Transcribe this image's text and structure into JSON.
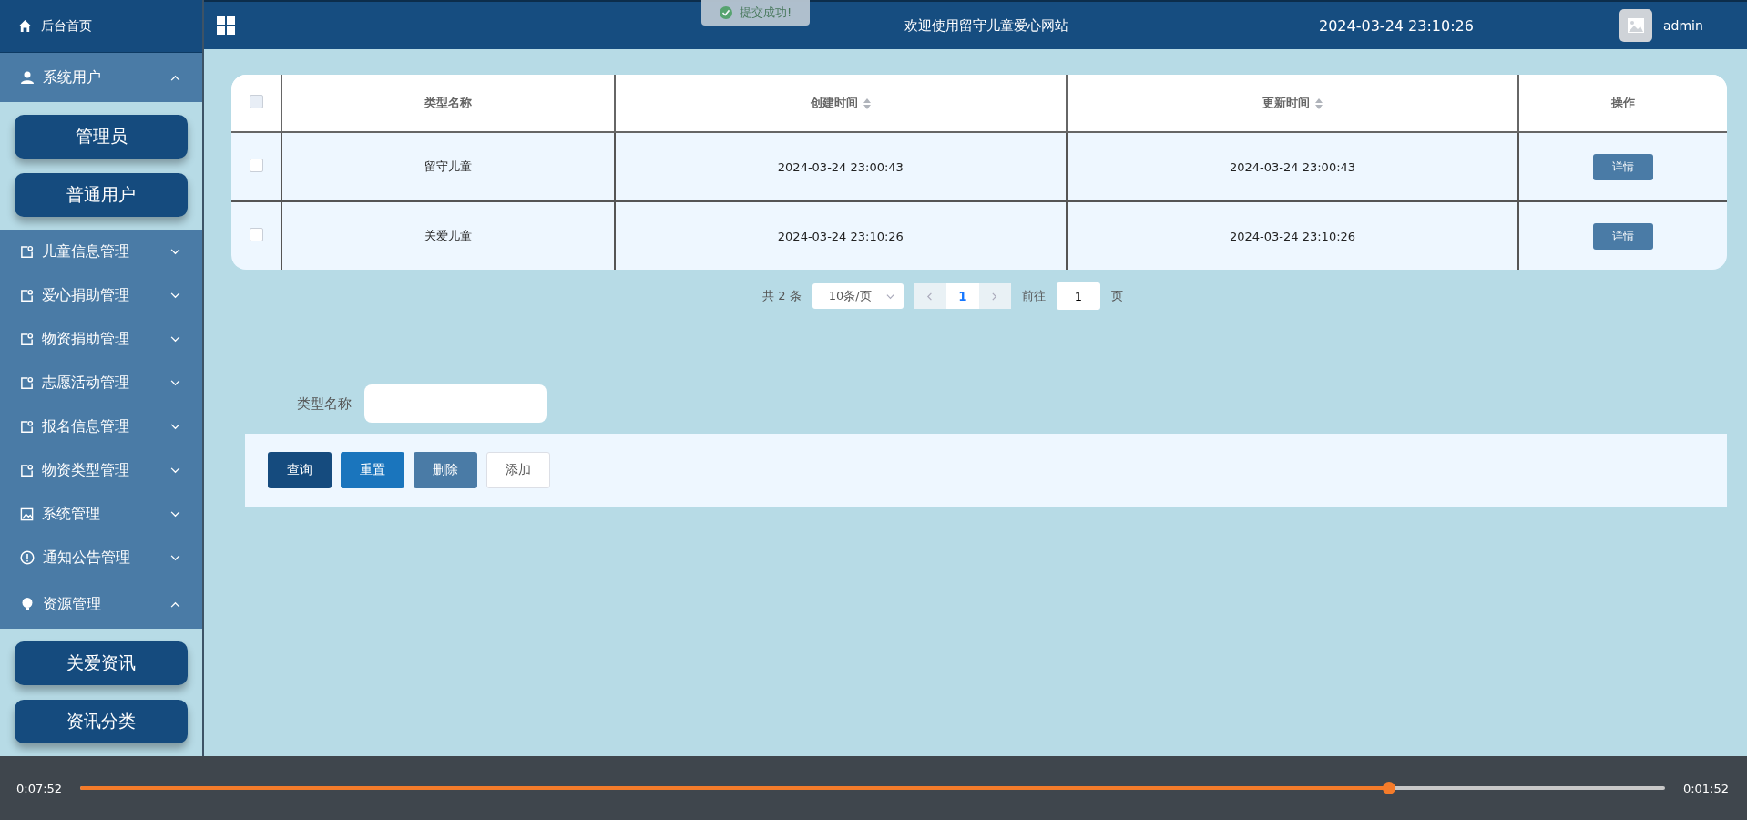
{
  "sidebar": {
    "home": {
      "label": "后台首页"
    },
    "menus": [
      {
        "label": "系统用户",
        "kind": "user",
        "expanded": true,
        "children": [
          {
            "label": "管理员"
          },
          {
            "label": "普通用户"
          }
        ]
      },
      {
        "label": "儿童信息管理",
        "kind": "tag",
        "expanded": false
      },
      {
        "label": "爱心捐助管理",
        "kind": "tag",
        "expanded": false
      },
      {
        "label": "物资捐助管理",
        "kind": "tag",
        "expanded": false
      },
      {
        "label": "志愿活动管理",
        "kind": "tag",
        "expanded": false
      },
      {
        "label": "报名信息管理",
        "kind": "tag",
        "expanded": false
      },
      {
        "label": "物资类型管理",
        "kind": "tag",
        "expanded": false
      },
      {
        "label": "系统管理",
        "kind": "picture",
        "expanded": false
      },
      {
        "label": "通知公告管理",
        "kind": "info",
        "expanded": false
      },
      {
        "label": "资源管理",
        "kind": "bulb",
        "expanded": true,
        "children": [
          {
            "label": "关爱资讯"
          },
          {
            "label": "资讯分类"
          }
        ]
      }
    ]
  },
  "header": {
    "title": "欢迎使用留守儿童爱心网站",
    "datetime": "2024-03-24 23:10:26",
    "user": "admin"
  },
  "toast": {
    "message": "提交成功!"
  },
  "table": {
    "select_all_checked": false,
    "columns": [
      {
        "label": "类型名称",
        "sortable": false
      },
      {
        "label": "创建时间",
        "sortable": true
      },
      {
        "label": "更新时间",
        "sortable": true
      },
      {
        "label": "操作",
        "sortable": false
      }
    ],
    "rows": [
      {
        "checked": false,
        "cells": [
          "留守儿童",
          "2024-03-24 23:00:43",
          "2024-03-24 23:00:43"
        ],
        "action": "详情"
      },
      {
        "checked": false,
        "cells": [
          "关爱儿童",
          "2024-03-24 23:10:26",
          "2024-03-24 23:10:26"
        ],
        "action": "详情"
      }
    ]
  },
  "pagination": {
    "total": "共 2 条",
    "page_size": "10条/页",
    "pages": [
      {
        "label": "1",
        "selected": true
      }
    ],
    "goto_label": "前往",
    "goto_value": "1",
    "goto_suffix": "页"
  },
  "search": {
    "label": "类型名称"
  },
  "actions": [
    {
      "label": "查询",
      "kind": "primary"
    },
    {
      "label": "重置",
      "kind": "info"
    },
    {
      "label": "删除",
      "kind": "danger"
    },
    {
      "label": "添加",
      "kind": "plain"
    }
  ],
  "player": {
    "current_time": "0:07:52",
    "duration": "0:01:52",
    "level": 0.826
  }
}
